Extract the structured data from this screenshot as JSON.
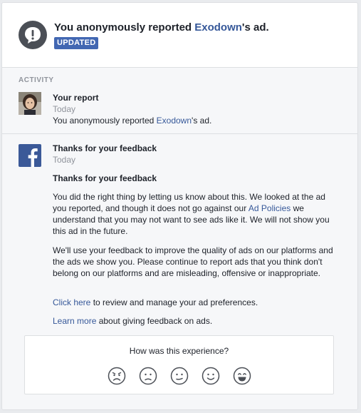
{
  "header": {
    "title_prefix": "You anonymously reported ",
    "advertiser": "Exodown",
    "title_suffix": "'s ad.",
    "badge": "UPDATED"
  },
  "activity": {
    "label": "ACTIVITY",
    "entry": {
      "title": "Your report",
      "time": "Today",
      "text_prefix": "You anonymously reported ",
      "advertiser": "Exodown",
      "text_suffix": "'s ad."
    }
  },
  "feedback": {
    "title": "Thanks for your feedback",
    "time": "Today",
    "heading": "Thanks for your feedback",
    "para1_prefix": "You did the right thing by letting us know about this. We looked at the ad you reported, and though it does not go against our ",
    "para1_link": "Ad Policies",
    "para1_suffix": " we understand that you may not want to see ads like it. We will not show you this ad in the future.",
    "para2": "We'll use your feedback to improve the quality of ads on our platforms and the ads we show you. Please continue to report ads that you think don't belong on our platforms and are misleading, offensive or inappropriate.",
    "click_here": "Click here",
    "click_here_suffix": " to review and manage your ad preferences.",
    "learn_more": "Learn more",
    "learn_more_suffix": " about giving feedback on ads."
  },
  "survey": {
    "question": "How was this experience?",
    "options": [
      "very-sad-face-icon",
      "sad-face-icon",
      "neutral-face-icon",
      "happy-face-icon",
      "very-happy-face-icon"
    ]
  },
  "colors": {
    "link": "#365899",
    "badge": "#4267b2",
    "facebook_blue": "#3b5998",
    "alert_icon": "#4b4f56"
  }
}
